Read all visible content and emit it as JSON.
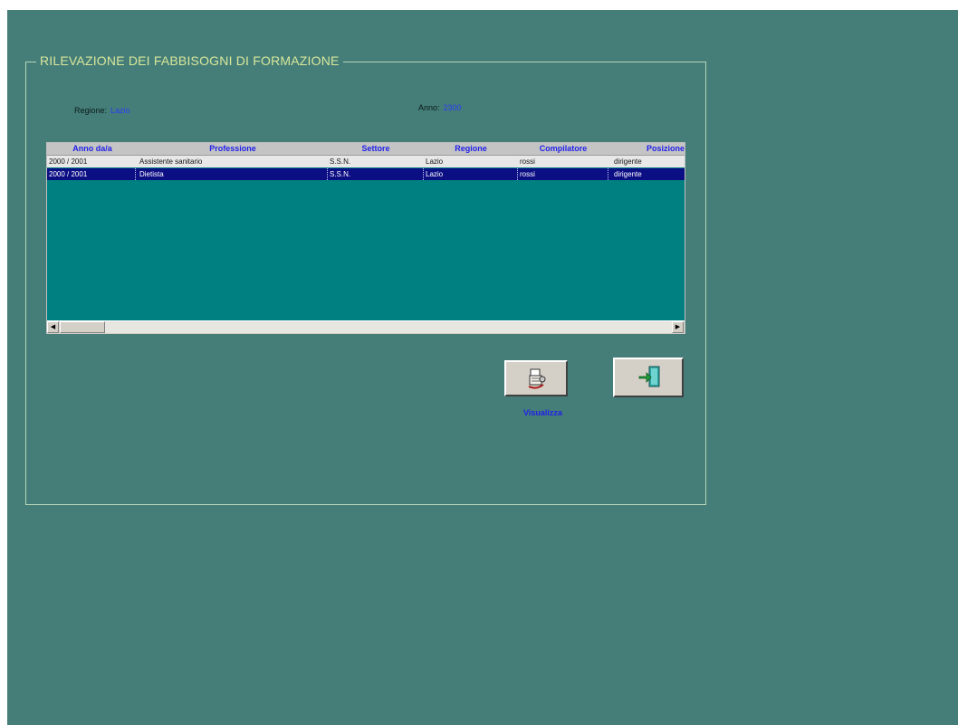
{
  "form": {
    "title": "RILEVAZIONE DEI FABBISOGNI DI FORMAZIONE",
    "regione_label": "Regione:",
    "regione_value": "Lazio",
    "anno_label": "Anno:",
    "anno_value": "2300"
  },
  "table": {
    "columns": [
      "Anno da/a",
      "Professione",
      "Settore",
      "Regione",
      "Compilatore",
      "Posizione"
    ],
    "rows": [
      [
        "2000 / 2001",
        "Assistente sanitario",
        "S.S.N.",
        "Lazio",
        "rossi",
        "dirigente"
      ],
      [
        "2000 / 2001",
        "Dietista",
        "S.S.N.",
        "Lazio",
        "rossi",
        "dirigente"
      ]
    ],
    "selected_row": 1
  },
  "buttons": {
    "view_caption": "Visualizza",
    "view_icon": "document-view-icon",
    "exit_icon": "exit-door-icon"
  },
  "colors": {
    "background": "#457e79",
    "grid_background": "#008080",
    "selected_row": "#0c0e84",
    "header_text": "#2121e8",
    "title_text": "#d8e79a"
  }
}
